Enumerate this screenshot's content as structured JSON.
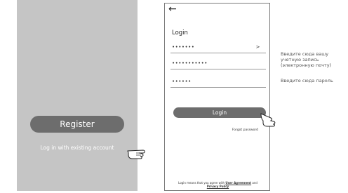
{
  "register_screen": {
    "register_label": "Register",
    "existing_account_label": "Log in with existing account"
  },
  "login_screen": {
    "back_icon": "arrow-left-icon",
    "title": "Login",
    "fields": [
      {
        "value": "•••••••",
        "chevron": ">"
      },
      {
        "value": "•••••••••••"
      },
      {
        "value": "••••••"
      }
    ],
    "login_label": "Login",
    "forgot_label": "Forgot password",
    "agreement": {
      "prefix": "Login means that you agree with",
      "user_agreement": "User Agreement",
      "and": "and",
      "privacy_policy": "Privacy Policy"
    }
  },
  "annotations": {
    "account_note": [
      "Введите сюда вашу",
      "учетную запись",
      "(электронную почту)"
    ],
    "password_note": "Введите сюда пароль"
  },
  "colors": {
    "left_bg": "#c5c5c5",
    "button": "#6d6d6d",
    "frame": "#7a7a7a"
  }
}
